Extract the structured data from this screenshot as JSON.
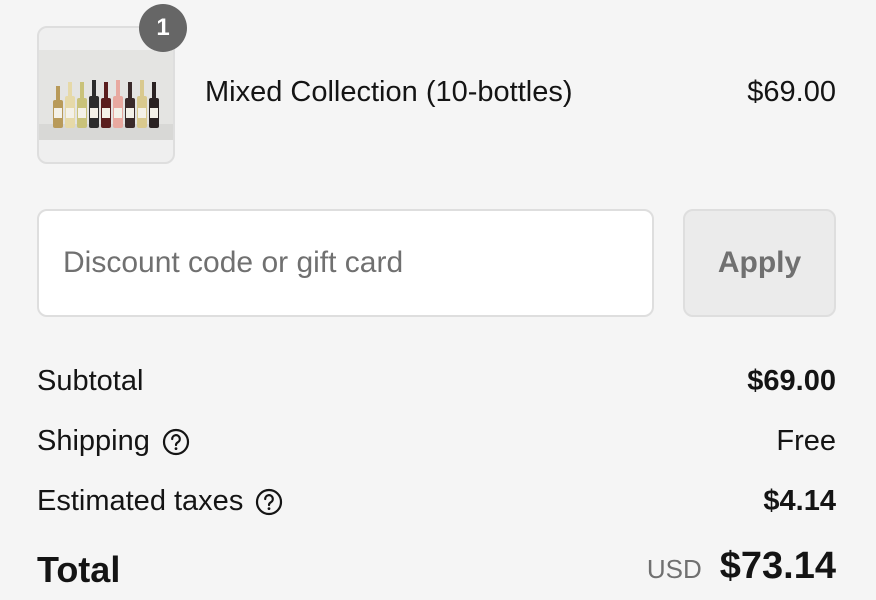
{
  "line_item": {
    "quantity": "1",
    "name": "Mixed Collection (10-bottles)",
    "price": "$69.00",
    "image_icon": "wine-bottles-photo"
  },
  "discount": {
    "placeholder": "Discount code or gift card",
    "value": "",
    "apply_label": "Apply"
  },
  "summary": {
    "subtotal_label": "Subtotal",
    "subtotal_value": "$69.00",
    "shipping_label": "Shipping",
    "shipping_value": "Free",
    "taxes_label": "Estimated taxes",
    "taxes_value": "$4.14",
    "help_icon": "question-circle-icon"
  },
  "total": {
    "label": "Total",
    "currency": "USD",
    "value": "$73.14"
  },
  "colors": {
    "background": "#f5f5f5",
    "text": "#141414",
    "muted": "#707070",
    "badge": "#666666",
    "border": "#dedede"
  }
}
